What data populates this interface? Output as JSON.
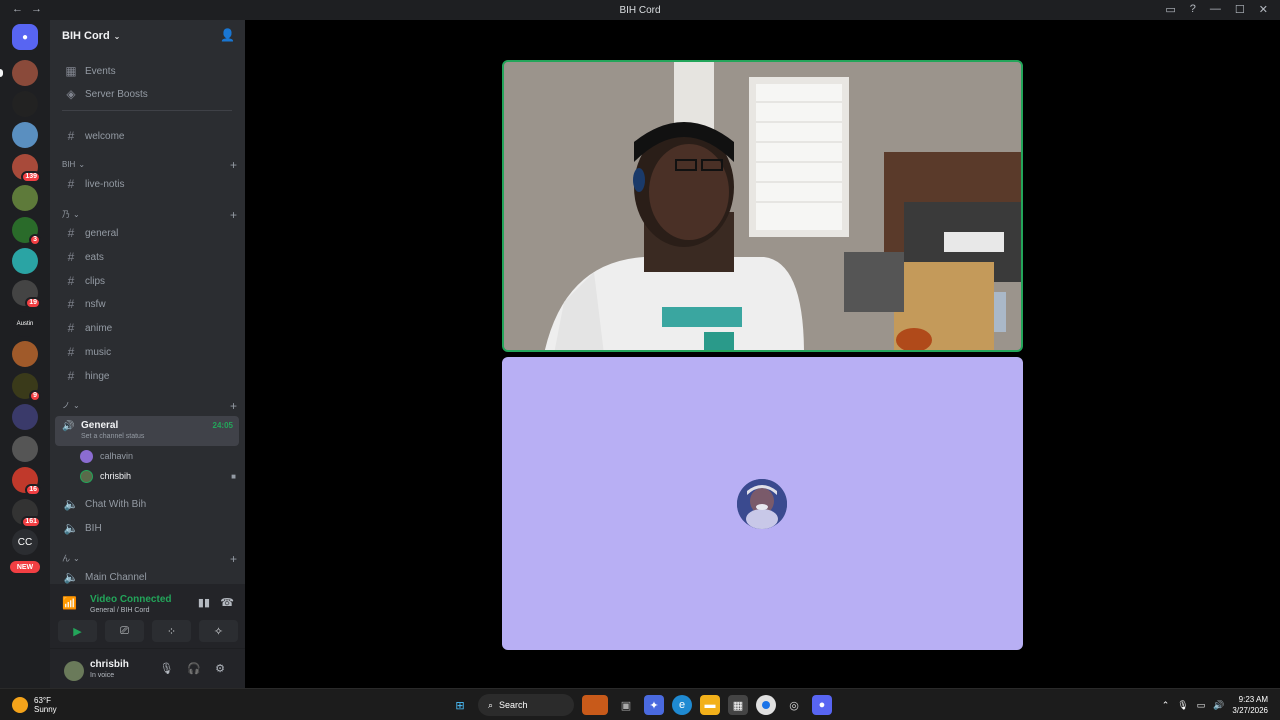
{
  "window": {
    "title": "BIH Cord"
  },
  "server": {
    "name": "BIH Cord"
  },
  "nav_items": [
    {
      "label": "Events",
      "icon": "calendar-icon"
    },
    {
      "label": "Server Boosts",
      "icon": "boost-icon"
    }
  ],
  "channels": {
    "welcome": "welcome",
    "category_1": "BIH",
    "live_notis": "live-notis",
    "category_2": "乃",
    "text": [
      "general",
      "eats",
      "clips",
      "nsfw",
      "anime",
      "music",
      "hinge"
    ],
    "category_3": "ノ",
    "active_voice": {
      "name": "General",
      "status": "Set a channel status",
      "timer": "24:05"
    },
    "members": [
      "calhavin",
      "chrisbih"
    ],
    "voice_other": [
      "Chat With Bih",
      "BIH"
    ],
    "category_4": "ん",
    "main_channel": "Main Channel"
  },
  "guild_badges": [
    "139",
    "3",
    "19",
    "9",
    "16",
    "161"
  ],
  "guild_labels": {
    "cc": "CC",
    "new": "NEW"
  },
  "voice_panel": {
    "status": "Video Connected",
    "location": "General / BIH Cord"
  },
  "user": {
    "name": "chrisbih",
    "status": "In voice"
  },
  "taskbar": {
    "temp": "63°F",
    "condition": "Sunny",
    "search": "Search",
    "time": "9:23 AM",
    "date": "3/27/2026"
  },
  "colors": {
    "accent": "#23a55a",
    "tile_purple": "#b8aff4",
    "sidebar": "#2b2d31"
  }
}
